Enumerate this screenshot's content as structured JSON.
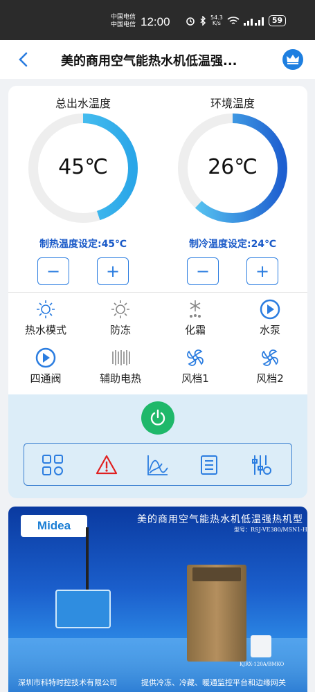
{
  "status_bar": {
    "carrier_1": "中国电信",
    "carrier_2": "中国电信",
    "time": "12:00",
    "net_speed_value": "54.3",
    "net_speed_unit": "K/s",
    "battery": "59",
    "icons": [
      "alarm-icon",
      "bluetooth-icon",
      "wifi-icon",
      "signal-icon"
    ]
  },
  "header": {
    "title": "美的商用空气能热水机低温强..."
  },
  "gauges": [
    {
      "title": "总出水温度",
      "value": "45℃",
      "setpoint_label": "制热温度设定:45℃",
      "level": 0.45
    },
    {
      "title": "环境温度",
      "value": "26℃",
      "setpoint_label": "制冷温度设定:24℃",
      "level": 0.62
    }
  ],
  "stepper": {
    "minus": "−",
    "plus": "+"
  },
  "status_items": [
    {
      "label": "热水模式",
      "icon": "sun-icon",
      "color": "#2b7de0"
    },
    {
      "label": "防冻",
      "icon": "sun-icon",
      "color": "#888888"
    },
    {
      "label": "化霜",
      "icon": "snowflake-drops-icon",
      "color": "#888888"
    },
    {
      "label": "水泵",
      "icon": "pump-icon",
      "color": "#2b7de0"
    },
    {
      "label": "四通阀",
      "icon": "valve-icon",
      "color": "#2b7de0"
    },
    {
      "label": "辅助电热",
      "icon": "heater-icon",
      "color": "#888888"
    },
    {
      "label": "风档1",
      "icon": "fan-icon",
      "color": "#2b7de0"
    },
    {
      "label": "风档2",
      "icon": "fan-icon",
      "color": "#2b7de0"
    }
  ],
  "toolbar": {
    "icons": [
      "grid-icon",
      "alarm-warning-icon",
      "curve-chart-icon",
      "list-document-icon",
      "settings-sliders-icon"
    ]
  },
  "banner": {
    "brand": "Midea",
    "title": "美的商用空气能热水机低温强热机型",
    "model": "型号：RSJ-VE380/MSN1-H",
    "unit_model": "KJRX-120A/BMKO",
    "footer_left": "深圳市科特时控技术有限公司",
    "footer_right": "提供冷冻、冷藏、暖通监控平台和边缘网关"
  },
  "colors": {
    "accent": "#2b7de0",
    "setpoint_text": "#1a5ac8",
    "gauge_track": "#eeeeee",
    "gauge_start": "#5fd2f5",
    "gauge_end": "#1e5fd0",
    "power_green": "#1fb86a",
    "alarm_red": "#e02020"
  }
}
